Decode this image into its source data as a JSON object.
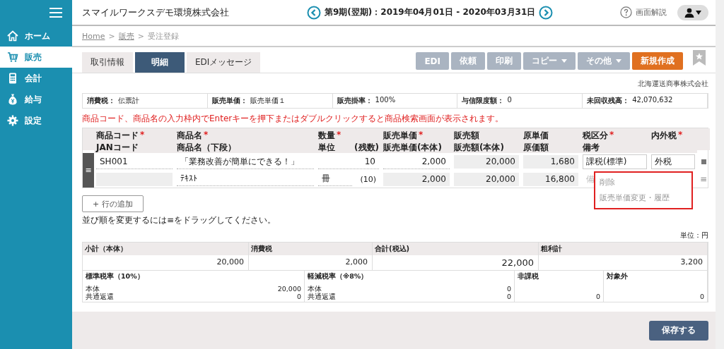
{
  "sidebar": {
    "items": [
      {
        "label": "ホーム",
        "selected": false
      },
      {
        "label": "販売",
        "selected": true
      },
      {
        "label": "会計",
        "selected": false
      },
      {
        "label": "給与",
        "selected": false
      },
      {
        "label": "設定",
        "selected": false
      }
    ]
  },
  "header": {
    "company": "スマイルワークスデモ環境株式会社",
    "period": "第9期(翌期)：2019年04月01日 - 2020年03月31日",
    "help": "画面解説"
  },
  "breadcrumb": [
    {
      "label": "Home",
      "link": true
    },
    {
      "label": ">",
      "link": false
    },
    {
      "label": "販売",
      "link": true
    },
    {
      "label": ">",
      "link": false
    },
    {
      "label": "受注登録",
      "link": false
    }
  ],
  "tabs": [
    {
      "label": "取引情報",
      "selected": false
    },
    {
      "label": "明細",
      "selected": true
    },
    {
      "label": "EDIメッセージ",
      "selected": false
    }
  ],
  "action_buttons": [
    {
      "label": "EDI",
      "kind": "plain",
      "disabled": true
    },
    {
      "label": "依頼",
      "kind": "plain",
      "disabled": true
    },
    {
      "label": "印刷",
      "kind": "plain",
      "disabled": true
    },
    {
      "label": "コピー",
      "kind": "dropdown",
      "disabled": true
    },
    {
      "label": "その他",
      "kind": "dropdown",
      "disabled": true
    },
    {
      "label": "新規作成",
      "kind": "primary",
      "disabled": false
    }
  ],
  "customer": "北海運送商事株式会社",
  "info_bar": [
    {
      "label": "消費税：",
      "value": "伝票計"
    },
    {
      "label": "販売単価：",
      "value": "販売単価１"
    },
    {
      "label": "販売掛率：",
      "value": "100%"
    },
    {
      "label": "与信限度額：",
      "value": "0"
    },
    {
      "label": "未回収残高：",
      "value": "42,070,632"
    }
  ],
  "notice": "商品コード、商品名の入力枠内でEnterキーを押下またはダブルクリックすると商品検索画面が表示されます。",
  "table": {
    "drag_handle": "≡",
    "row_handle": "≡",
    "columns": [
      {
        "line1": "商品コード",
        "required_mark": "*",
        "line2": "JANコード"
      },
      {
        "line1": "商品名",
        "required_mark": "*",
        "line2": "商品名（下段）"
      },
      {
        "line1": "数量",
        "required_mark": "*",
        "line2": "単位",
        "line2_extra": "(残数)"
      },
      {
        "line1": "販売単価",
        "required_mark": "*",
        "line2": "販売単価(本体)"
      },
      {
        "line1": "販売額",
        "line2": "販売額(本体)"
      },
      {
        "line1": "原単価",
        "line2": "原価額"
      },
      {
        "line1": "税区分",
        "required_mark": "*",
        "line2": "備考"
      },
      {
        "line1": "内外税",
        "required_mark": "*"
      }
    ],
    "rows": [
      {
        "code": "SH001",
        "name": "「業務改善が簡単にできる！」",
        "quantity": "10",
        "unit_price": "2,000",
        "amount": "20,000",
        "unit_cost": "1,680",
        "tax_class": "課税(標準)",
        "tax_mode": "外税",
        "sub_name": "ﾃｷｽﾄ",
        "unit": "冊",
        "remaining": "(10)",
        "net_price": "2,000",
        "net_amount": "20,000",
        "cost_amount": "16,800",
        "remark": "備"
      }
    ]
  },
  "context_menu": {
    "items": [
      "削除",
      "販売単価変更・履歴"
    ]
  },
  "add_row_button": "+ 行の追加",
  "drag_hint": "並び順を変更するには≡をドラッグしてください。",
  "unit": "単位：円",
  "totals": [
    {
      "label": "小計（本体）",
      "value": "20,000",
      "emphasized": false
    },
    {
      "label": "消費税",
      "value": "2,000",
      "emphasized": false
    },
    {
      "label": "合計(税込)",
      "value": "22,000",
      "emphasized": true
    },
    {
      "label": "粗利計",
      "value": "3,200",
      "emphasized": false
    }
  ],
  "tax_sections": [
    {
      "title": "標準税率（10%）",
      "rows": [
        {
          "label": "本体",
          "value": "20,000"
        },
        {
          "label": "共通返還",
          "value": "0"
        }
      ]
    },
    {
      "title": "軽減税率（※8%）",
      "rows": [
        {
          "label": "本体",
          "value": "0"
        },
        {
          "label": "共通返還",
          "value": "0"
        }
      ]
    },
    {
      "title": "非課税",
      "rows": [
        {
          "value": "0"
        }
      ]
    },
    {
      "title": "対象外",
      "rows": [
        {
          "value": "0"
        }
      ]
    }
  ],
  "save_button": "保存する"
}
